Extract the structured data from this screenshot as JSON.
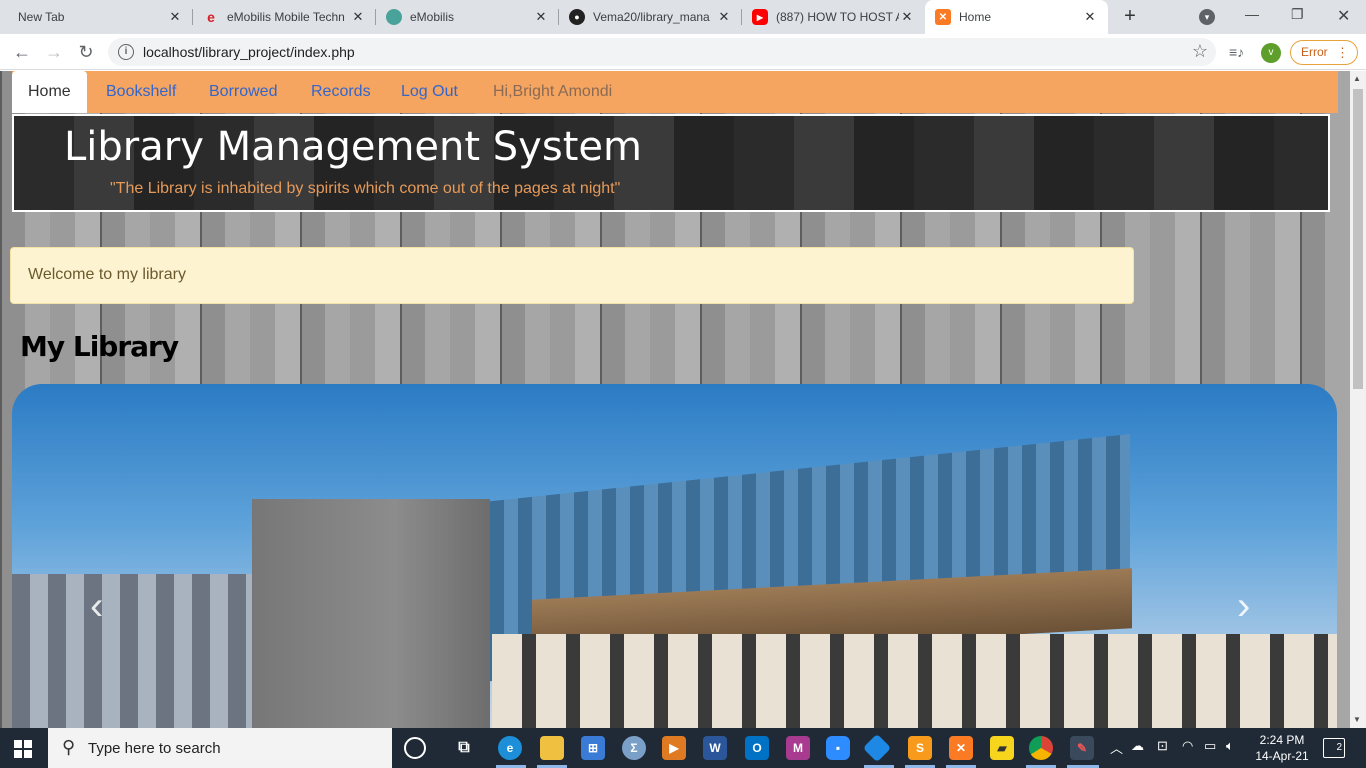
{
  "browser": {
    "tabs": [
      {
        "label": "New Tab",
        "favicon": "none"
      },
      {
        "label": "eMobilis Mobile Techn",
        "favicon": "e"
      },
      {
        "label": "eMobilis",
        "favicon": "globe"
      },
      {
        "label": "Vema20/library_mana",
        "favicon": "github"
      },
      {
        "label": "(887) HOW TO HOST A",
        "favicon": "youtube"
      },
      {
        "label": "Home",
        "favicon": "xampp"
      }
    ],
    "new_tab": "+",
    "url": "localhost/library_project/index.php",
    "profile_initial": "v",
    "error_label": "Error"
  },
  "navbar": {
    "items": [
      {
        "label": "Home"
      },
      {
        "label": "Bookshelf"
      },
      {
        "label": "Borrowed"
      },
      {
        "label": "Records"
      },
      {
        "label": "Log Out"
      }
    ],
    "greeting": "Hi,Bright Amondi",
    "color": "#f5a55f"
  },
  "banner": {
    "title": "Library Management System",
    "quote": "\"The Library is inhabited by spirits which come out of the pages at night\""
  },
  "welcome": "Welcome to my library",
  "section_title": "My Library",
  "carousel": {
    "prev": "‹",
    "next": "›"
  },
  "taskbar": {
    "search_placeholder": "Type here to search",
    "time": "2:24 PM",
    "date": "14-Apr-21",
    "notifications": "2"
  }
}
